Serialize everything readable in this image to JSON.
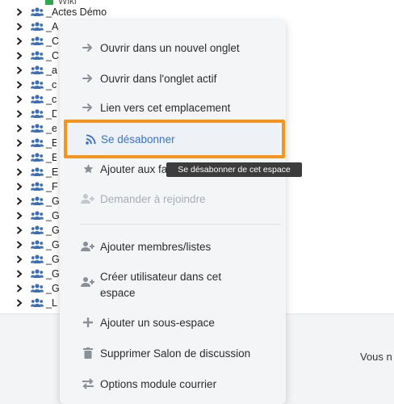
{
  "tree": {
    "top_fragment": "Wiki",
    "rows": [
      {
        "label": "_Actes Démo"
      },
      {
        "label": "_A"
      },
      {
        "label": "_C"
      },
      {
        "label": "_C"
      },
      {
        "label": "_a"
      },
      {
        "label": "_c"
      },
      {
        "label": "_c"
      },
      {
        "label": "_D"
      },
      {
        "label": "_e"
      },
      {
        "label": "_E"
      },
      {
        "label": "_E"
      },
      {
        "label": "_E"
      },
      {
        "label": "_F"
      },
      {
        "label": "_G"
      },
      {
        "label": "_G"
      },
      {
        "label": "_G"
      },
      {
        "label": "_G"
      },
      {
        "label": "_G"
      },
      {
        "label": "_G"
      },
      {
        "label": "_G"
      },
      {
        "label": "_L"
      }
    ]
  },
  "menu": {
    "open_new_tab": "Ouvrir dans un nouvel onglet",
    "open_active_tab": "Ouvrir dans l'onglet actif",
    "link_to_location": "Lien vers cet emplacement",
    "unsubscribe": "Se désabonner",
    "add_favorites": "Ajouter aux fa",
    "request_join": "Demander à rejoindre",
    "add_members": "Ajouter membres/listes",
    "create_user": "Créer utilisateur dans cet espace",
    "add_subspace": "Ajouter un sous-espace",
    "delete_chat": "Supprimer Salon de discussion",
    "mail_options": "Options module courrier"
  },
  "tooltip": "Se désabonner de cet espace",
  "right_fragment": "Vous n",
  "colors": {
    "accent_blue": "#3a72c9",
    "focus_orange": "#f7941d",
    "group_icon": "#3a6fb7"
  }
}
